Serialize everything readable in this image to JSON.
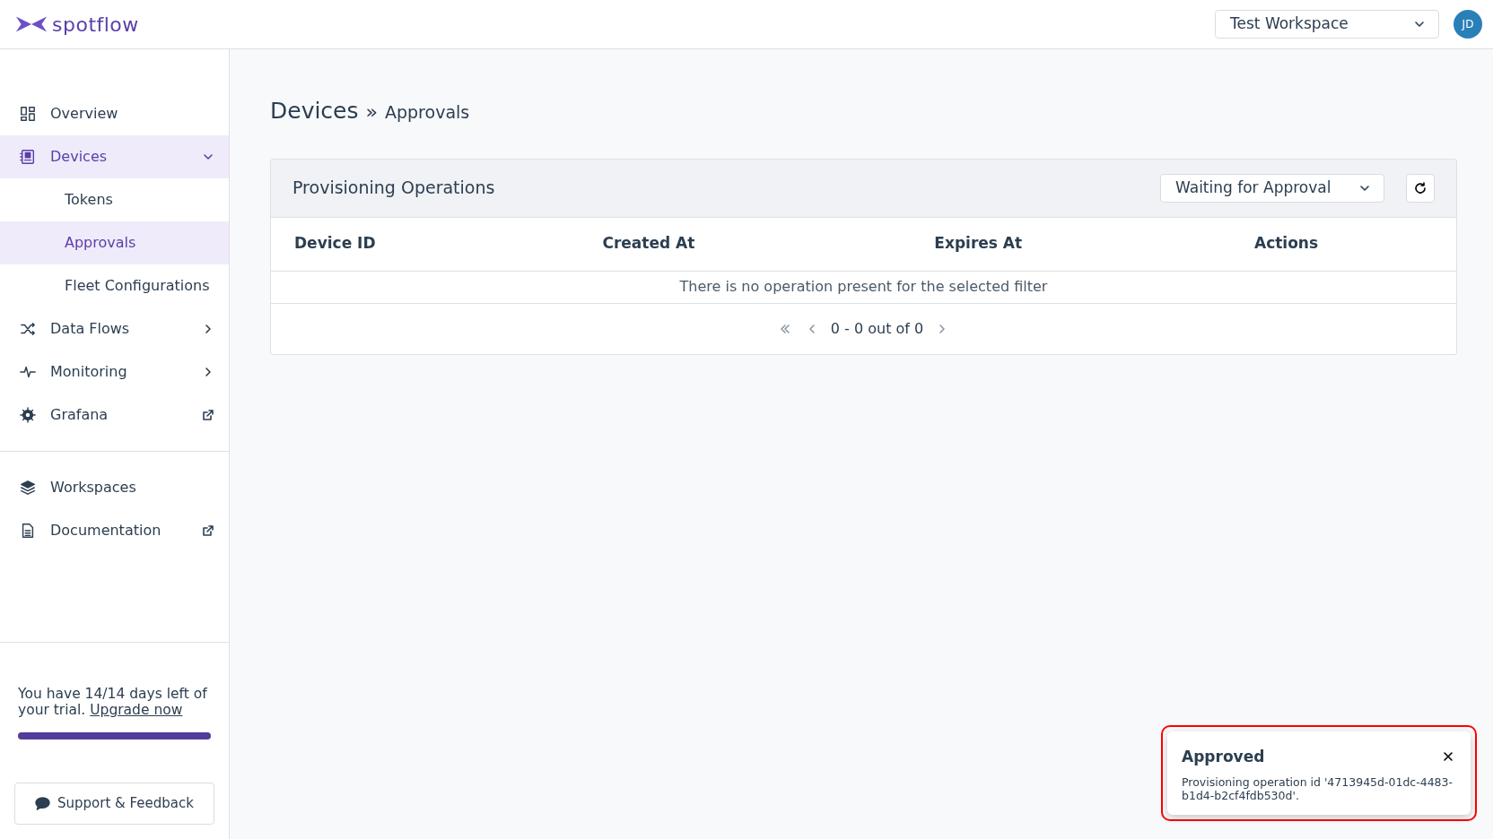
{
  "header": {
    "logo_text": "spotflow",
    "workspace": "Test Workspace",
    "avatar": "JD"
  },
  "sidebar": {
    "items": [
      {
        "label": "Overview",
        "selected": false
      },
      {
        "label": "Devices",
        "selected": true,
        "expanded": true,
        "children": [
          {
            "label": "Tokens",
            "selected": false
          },
          {
            "label": "Approvals",
            "selected": true
          },
          {
            "label": "Fleet Configurations",
            "selected": false
          }
        ]
      },
      {
        "label": "Data Flows",
        "selected": false,
        "expanded": false
      },
      {
        "label": "Monitoring",
        "selected": false,
        "expanded": false
      },
      {
        "label": "Grafana",
        "selected": false,
        "external": true
      }
    ],
    "secondary_items": [
      {
        "label": "Workspaces",
        "selected": false
      },
      {
        "label": "Documentation",
        "selected": false,
        "external": true
      }
    ],
    "trial": {
      "text": "You have 14/14 days left of your trial.",
      "link": "Upgrade now",
      "level": 1.0
    },
    "support_button": "Support & Feedback"
  },
  "breadcrumb": {
    "title": "Devices",
    "separator": "»",
    "current": "Approvals"
  },
  "panel": {
    "title": "Provisioning Operations",
    "filter": "Waiting for Approval",
    "table": {
      "columns": [
        "Device ID",
        "Created At",
        "Expires At",
        "Actions"
      ],
      "empty_message": "There is no operation present for the selected filter"
    },
    "pagination": {
      "range": "0 - 0 out of 0"
    }
  },
  "toast": {
    "title": "Approved",
    "message": "Provisioning operation id '4713945d-01dc-4483-b1d4-b2cf4fdb530d'.",
    "highlighted": true
  }
}
